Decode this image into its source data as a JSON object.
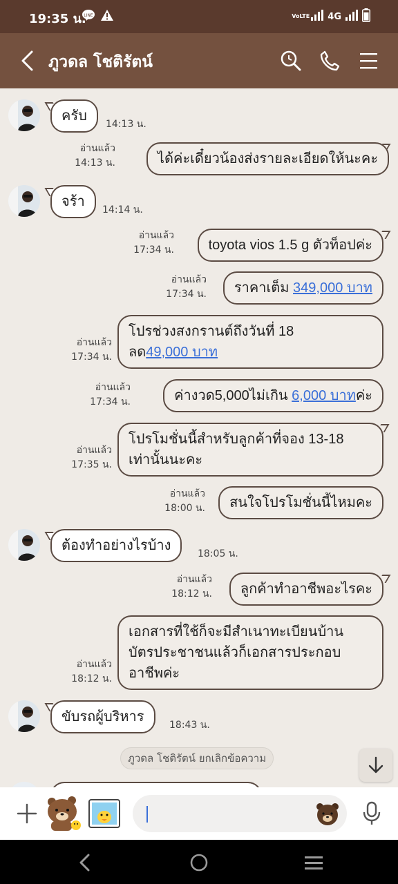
{
  "status_bar": {
    "time": "19:35 น.",
    "network_label": "4G",
    "volte_label": "VoLTE",
    "icons": [
      "line-notification-icon",
      "warning-icon",
      "volte-icon",
      "signal-icon",
      "signal-icon",
      "battery-icon"
    ]
  },
  "header": {
    "title": "ภูวดล โชติรัตน์",
    "icons": [
      "back-icon",
      "search-icon",
      "phone-icon",
      "menu-icon"
    ]
  },
  "messages": [
    {
      "id": 1,
      "side": "in",
      "text": "ครับ",
      "time": "14:13 น."
    },
    {
      "id": 2,
      "side": "out",
      "text": "ได้ค่ะเดี๋ยวน้องส่งรายละเอียดให้นะคะ",
      "read": "อ่านแล้ว",
      "time": "14:13 น."
    },
    {
      "id": 3,
      "side": "in",
      "text": "จร้า",
      "time": "14:14 น."
    },
    {
      "id": 4,
      "side": "out",
      "text": "toyota vios 1.5 g ตัวท็อปค่ะ",
      "read": "อ่านแล้ว",
      "time": "17:34 น."
    },
    {
      "id": 5,
      "side": "out",
      "text_prefix": "ราคาเต็ม ",
      "link": "349,000 บาท",
      "read": "อ่านแล้ว",
      "time": "17:34 น."
    },
    {
      "id": 6,
      "side": "out",
      "line1": "โปรช่วงสงกรานต์ถึงวันที่ 18",
      "line2_prefix": "ลด",
      "link": "49,000 บาท",
      "read": "อ่านแล้ว",
      "time": "17:34 น."
    },
    {
      "id": 7,
      "side": "out",
      "text_prefix": "ค่างวด5,000ไม่เกิน ",
      "link": "6,000 บาท",
      "text_suffix": "ค่ะ",
      "read": "อ่านแล้ว",
      "time": "17:34 น."
    },
    {
      "id": 8,
      "side": "out",
      "line1": "โปรโมชั่นนี้สำหรับลูกค้าที่จอง 13-18",
      "line2": "เท่านั้นนะคะ",
      "read": "อ่านแล้ว",
      "time": "17:35 น."
    },
    {
      "id": 9,
      "side": "out",
      "text": "สนใจโปรโมชั่นนี้ไหมคะ",
      "read": "อ่านแล้ว",
      "time": "18:00 น."
    },
    {
      "id": 10,
      "side": "in",
      "text": "ต้องทำอย่างไรบ้าง",
      "time": "18:05 น."
    },
    {
      "id": 11,
      "side": "out",
      "text": "ลูกค้าทำอาชีพอะไรคะ",
      "read": "อ่านแล้ว",
      "time": "18:12 น."
    },
    {
      "id": 12,
      "side": "out",
      "line1": "เอกสารที่ใช้ก็จะมีสำเนาทะเบียนบ้าน",
      "line2": "บัตรประชาชนแล้วก็เอกสารประกอบ",
      "line3": "อาชีพค่ะ",
      "read": "อ่านแล้ว",
      "time": "18:12 น."
    },
    {
      "id": 13,
      "side": "in",
      "text": "ขับรถผู้บริหาร",
      "time": "18:43 น."
    }
  ],
  "system_message": "ภูวดล โชติรัตน์ ยกเลิกข้อความ",
  "input_bar": {
    "icons": [
      "plus-icon",
      "brown-bear-sticker-icon",
      "sticker-photo-icon",
      "emoji-bear-icon",
      "microphone-icon"
    ]
  },
  "nav_bar": {
    "icons": [
      "nav-back-icon",
      "nav-home-icon",
      "nav-recents-icon"
    ]
  },
  "colors": {
    "status_bar": "#5a3a2d",
    "header": "#74513f",
    "chat_background": "#efebe6",
    "bubble_border": "#5b4b43",
    "link": "#3a6fd8"
  }
}
